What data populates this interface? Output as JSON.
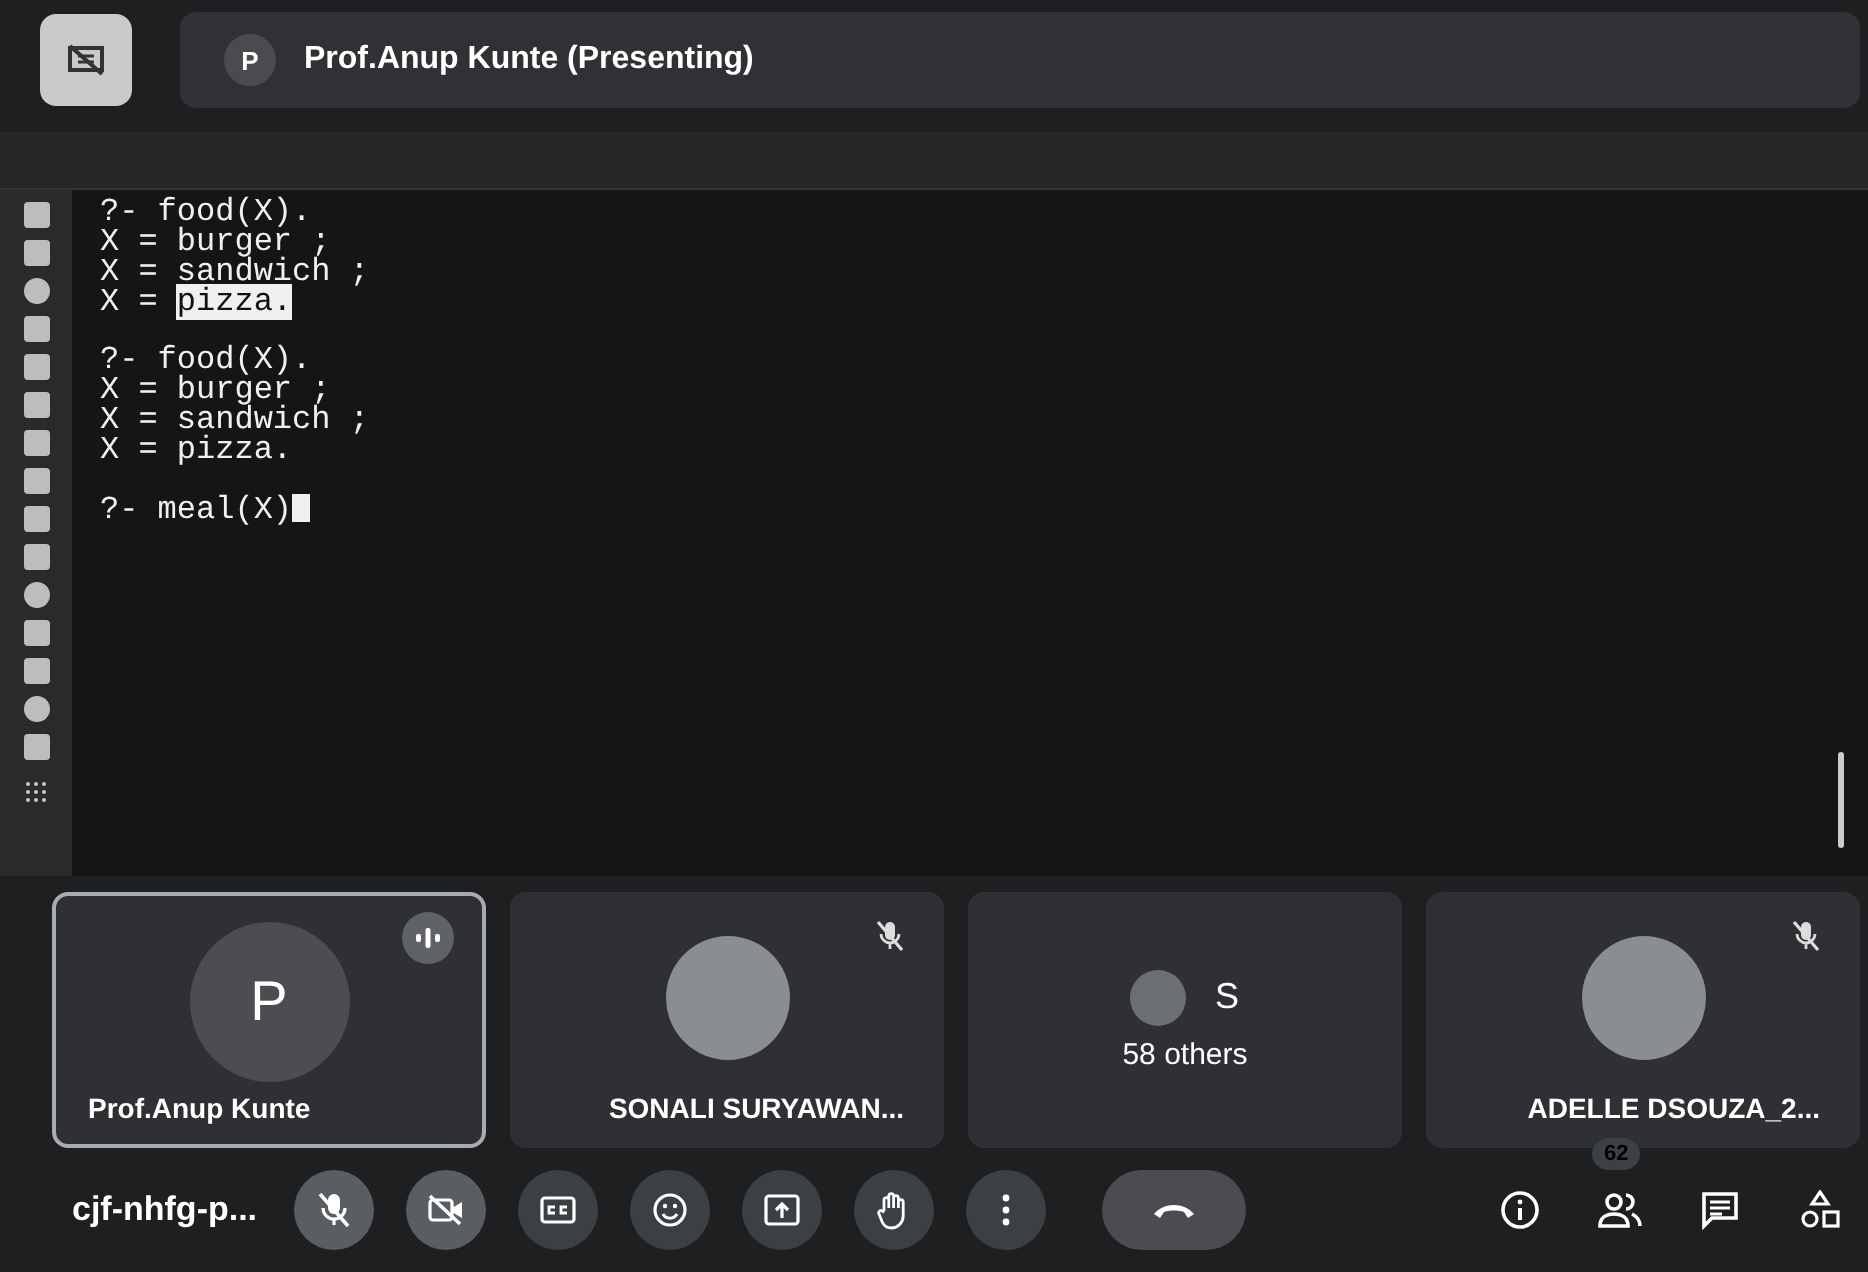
{
  "presenter": {
    "avatar_letter": "P",
    "label": "Prof.Anup Kunte (Presenting)"
  },
  "terminal": {
    "blocks": [
      {
        "lines": [
          {
            "text": "?- food(X)."
          },
          {
            "text": "X = burger ;"
          },
          {
            "text": "X = sandwich ;"
          },
          {
            "text": "X = ",
            "selection": "pizza."
          }
        ]
      },
      {
        "lines": [
          {
            "text": "?- food(X)."
          },
          {
            "text": "X = burger ;"
          },
          {
            "text": "X = sandwich ;"
          },
          {
            "text": "X = pizza."
          }
        ]
      },
      {
        "lines": [
          {
            "text": "?- meal(X)",
            "cursor": true
          }
        ]
      }
    ]
  },
  "tiles": [
    {
      "kind": "avatar",
      "letter": "P",
      "name": "Prof.Anup Kunte",
      "speaking": true,
      "muted": false
    },
    {
      "kind": "photo",
      "name": "SONALI SURYAWAN...",
      "speaking": false,
      "muted": true
    },
    {
      "kind": "group",
      "letter": "S",
      "caption": "58 others",
      "speaking": false,
      "muted": false
    },
    {
      "kind": "photo",
      "name": "ADELLE DSOUZA_2...",
      "speaking": false,
      "muted": true
    }
  ],
  "meeting_code": "cjf-nhfg-p...",
  "controls": [
    {
      "kind": "mic",
      "off": true
    },
    {
      "kind": "camera",
      "off": true
    },
    {
      "kind": "captions",
      "off": false
    },
    {
      "kind": "emoji",
      "off": false
    },
    {
      "kind": "present",
      "off": false
    },
    {
      "kind": "hand",
      "off": false
    },
    {
      "kind": "more",
      "off": false
    },
    {
      "kind": "hangup",
      "off": false
    }
  ],
  "side_controls": [
    {
      "kind": "info"
    },
    {
      "kind": "people",
      "badge": "62"
    },
    {
      "kind": "chat"
    },
    {
      "kind": "activities"
    }
  ]
}
